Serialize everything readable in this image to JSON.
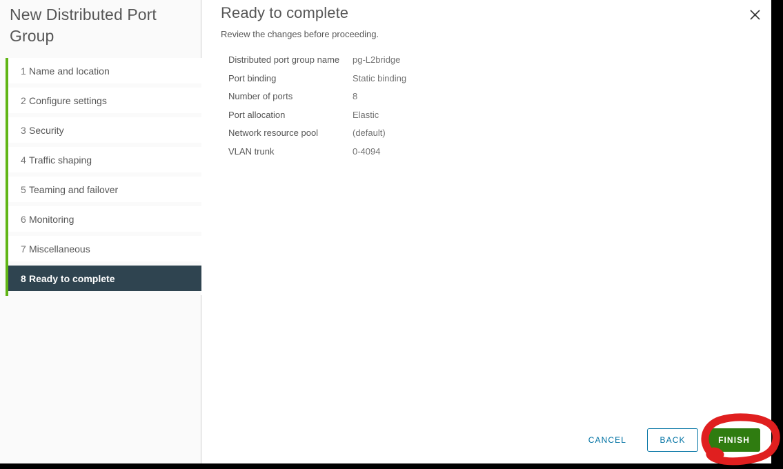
{
  "wizard": {
    "title": "New Distributed Port Group",
    "close_icon": "close-icon",
    "steps": [
      {
        "num": "1",
        "label": "Name and location",
        "active": false
      },
      {
        "num": "2",
        "label": "Configure settings",
        "active": false
      },
      {
        "num": "3",
        "label": "Security",
        "active": false
      },
      {
        "num": "4",
        "label": "Traffic shaping",
        "active": false
      },
      {
        "num": "5",
        "label": "Teaming and failover",
        "active": false
      },
      {
        "num": "6",
        "label": "Monitoring",
        "active": false
      },
      {
        "num": "7",
        "label": "Miscellaneous",
        "active": false
      },
      {
        "num": "8",
        "label": "Ready to complete",
        "active": true
      }
    ]
  },
  "content": {
    "heading": "Ready to complete",
    "subtitle": "Review the changes before proceeding.",
    "summary": [
      {
        "label": "Distributed port group name",
        "value": "pg-L2bridge"
      },
      {
        "label": "Port binding",
        "value": "Static binding"
      },
      {
        "label": "Number of ports",
        "value": "8"
      },
      {
        "label": "Port allocation",
        "value": "Elastic"
      },
      {
        "label": "Network resource pool",
        "value": "(default)"
      },
      {
        "label": "VLAN trunk",
        "value": "0-4094"
      }
    ]
  },
  "footer": {
    "cancel_label": "CANCEL",
    "back_label": "BACK",
    "finish_label": "FINISH"
  },
  "annotation": {
    "shape": "red-ellipse-highlight",
    "target": "finish-button",
    "color": "#e01f1f"
  },
  "colors": {
    "accent_green": "#60b515",
    "active_step_bg": "#2f4450",
    "link_blue": "#0072a3",
    "primary_green": "#2f7c10",
    "annotation_red": "#e01f1f"
  }
}
